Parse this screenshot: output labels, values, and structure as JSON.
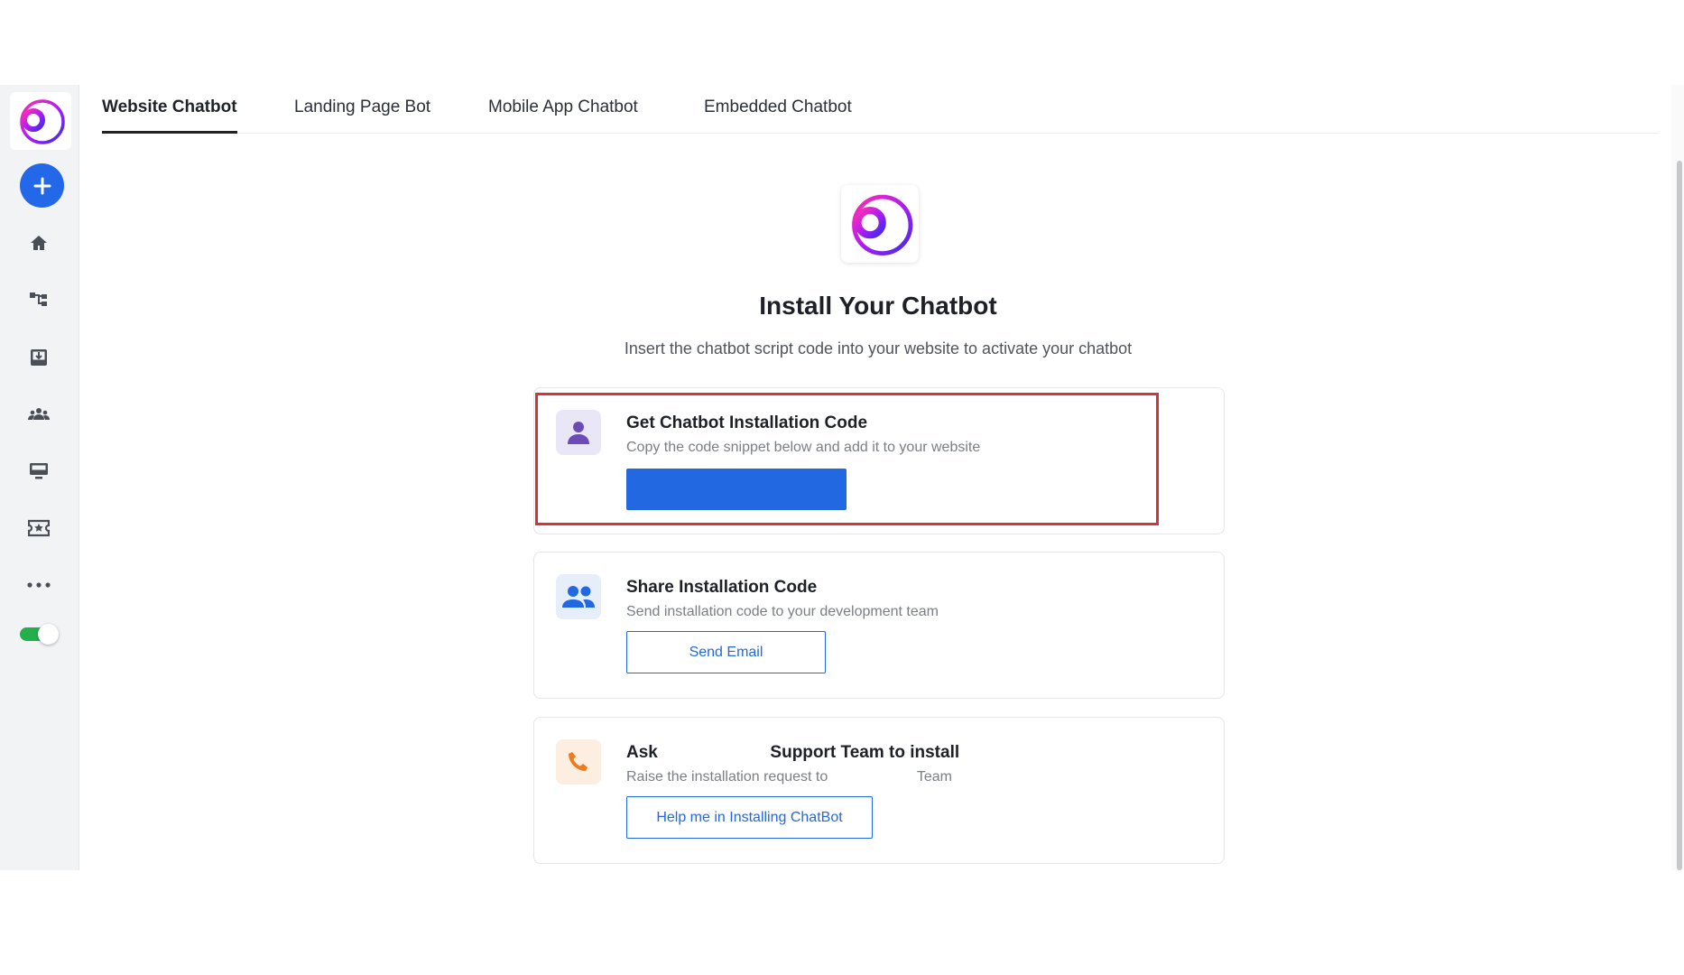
{
  "tabs": [
    {
      "label": "Website Chatbot",
      "active": true
    },
    {
      "label": "Landing Page Bot",
      "active": false
    },
    {
      "label": "Mobile App Chatbot",
      "active": false
    },
    {
      "label": "Embedded Chatbot",
      "active": false
    }
  ],
  "sidebar": {
    "items": [
      {
        "icon": "home-icon"
      },
      {
        "icon": "flow-icon"
      },
      {
        "icon": "inbox-icon"
      },
      {
        "icon": "team-icon"
      },
      {
        "icon": "monitor-icon"
      },
      {
        "icon": "ticket-icon"
      },
      {
        "icon": "more-icon"
      }
    ],
    "toggle_on": true
  },
  "hero": {
    "title": "Install Your Chatbot",
    "subtitle": "Insert the chatbot script code into your website to activate your chatbot"
  },
  "cards": [
    {
      "icon": "user-icon",
      "title": "Get Chatbot Installation Code",
      "description": "Copy the code snippet below and add it to your website",
      "button": ""
    },
    {
      "icon": "group-icon",
      "title": "Share Installation Code",
      "description": "Send installation code to your development team",
      "button": "Send Email"
    },
    {
      "icon": "phone-icon",
      "title_a": "Ask",
      "title_b": "Support Team to install",
      "description_a": "Raise the installation request to",
      "description_b": "Team",
      "button": "Help me in Installing ChatBot"
    }
  ],
  "colors": {
    "primary": "#2268e0",
    "highlight": "#d3343a",
    "toggle": "#22b04b",
    "user_icon_bg": "#e9e6f7",
    "group_icon_bg": "#e5eef9",
    "phone_icon_bg": "#fdeee2"
  }
}
